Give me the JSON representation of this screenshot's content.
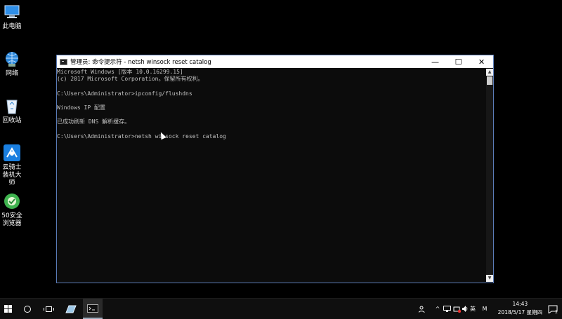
{
  "desktop": {
    "icons": [
      {
        "label": "此电脑",
        "icon": "computer-icon"
      },
      {
        "label": "网络",
        "icon": "network-icon"
      },
      {
        "label": "回收站",
        "icon": "recycle-bin-icon"
      },
      {
        "label": "云骑士装机大师",
        "icon": "yunqishi-icon"
      },
      {
        "label": "50安全浏览器",
        "icon": "browser-icon"
      }
    ]
  },
  "window": {
    "title": "管理员: 命令提示符 - netsh  winsock reset catalog",
    "buttons": {
      "minimize": "—",
      "maximize": "☐",
      "close": "✕"
    },
    "console_lines": [
      "Microsoft Windows [版本 10.0.16299.15]",
      "(c) 2017 Microsoft Corporation。保留所有权利。",
      "",
      "C:\\Users\\Administrator>ipconfig/flushdns",
      "",
      "Windows IP 配置",
      "",
      "已成功刷新 DNS 解析缓存。",
      "",
      "C:\\Users\\Administrator>netsh winsock reset catalog"
    ]
  },
  "taskbar": {
    "tray": {
      "ime_label": "英",
      "ime_mode": "M"
    },
    "clock": {
      "time": "14:43",
      "date": "2018/5/17 星期四"
    },
    "notification_count": "2"
  }
}
